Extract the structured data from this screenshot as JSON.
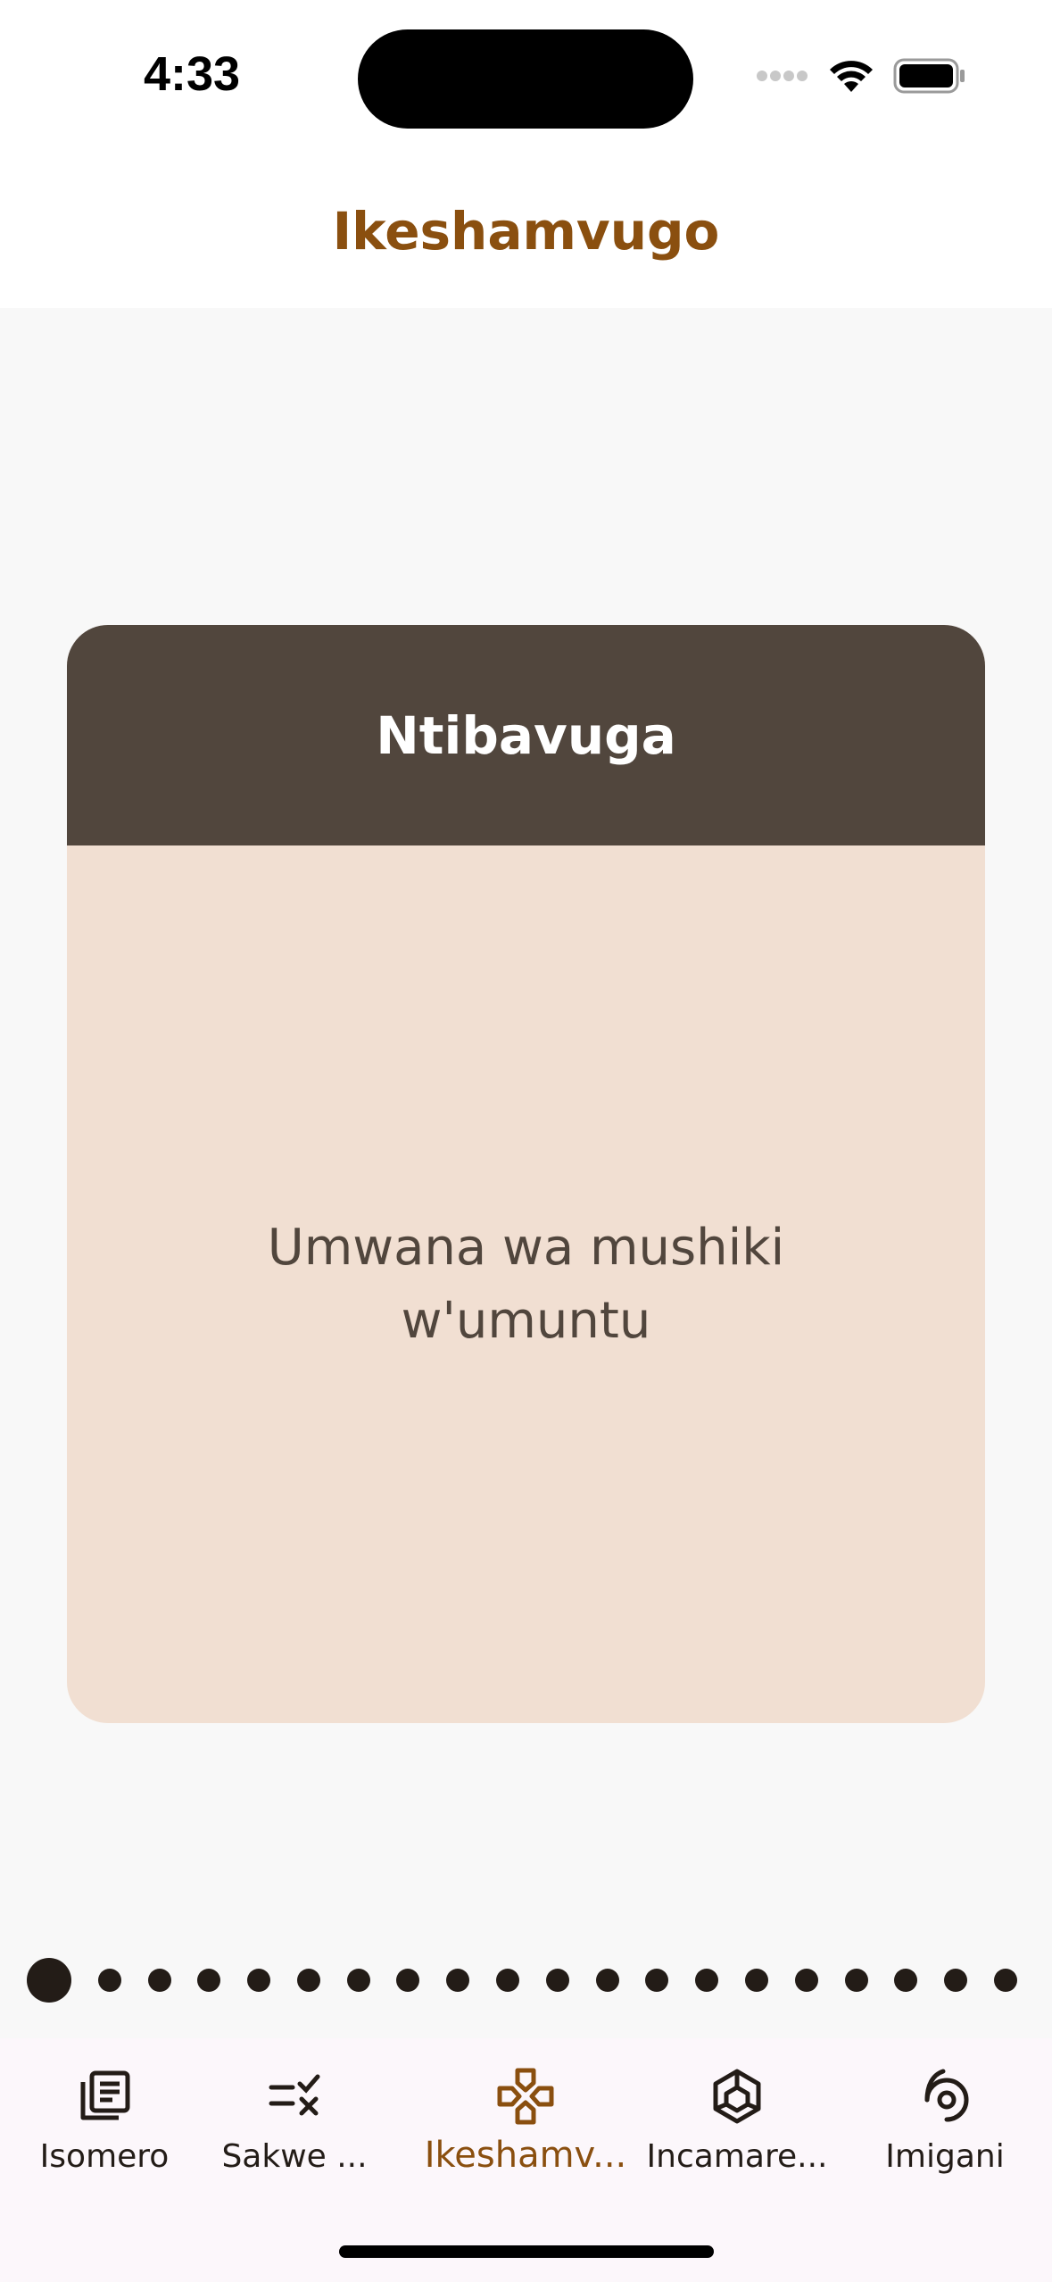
{
  "status": {
    "time": "4:33"
  },
  "header": {
    "title": "Ikeshamvugo"
  },
  "card": {
    "title": "Ntibavuga",
    "text": "Umwana wa mushiki w'umuntu"
  },
  "pager": {
    "total": 20,
    "current": 1
  },
  "tabs": [
    {
      "label": "Isomero",
      "icon": "library-icon",
      "active": false
    },
    {
      "label": "Sakwe ...",
      "icon": "quiz-icon",
      "active": false
    },
    {
      "label": "Ikeshamv...",
      "icon": "game-controller-icon",
      "active": true
    },
    {
      "label": "Incamare...",
      "icon": "cube-icon",
      "active": false
    },
    {
      "label": "Imigani",
      "icon": "spiral-icon",
      "active": false
    }
  ],
  "colors": {
    "accent": "#8a4f0f",
    "card_header": "#51463d",
    "card_body": "#f1dfd2",
    "text_dark": "#231c17"
  }
}
